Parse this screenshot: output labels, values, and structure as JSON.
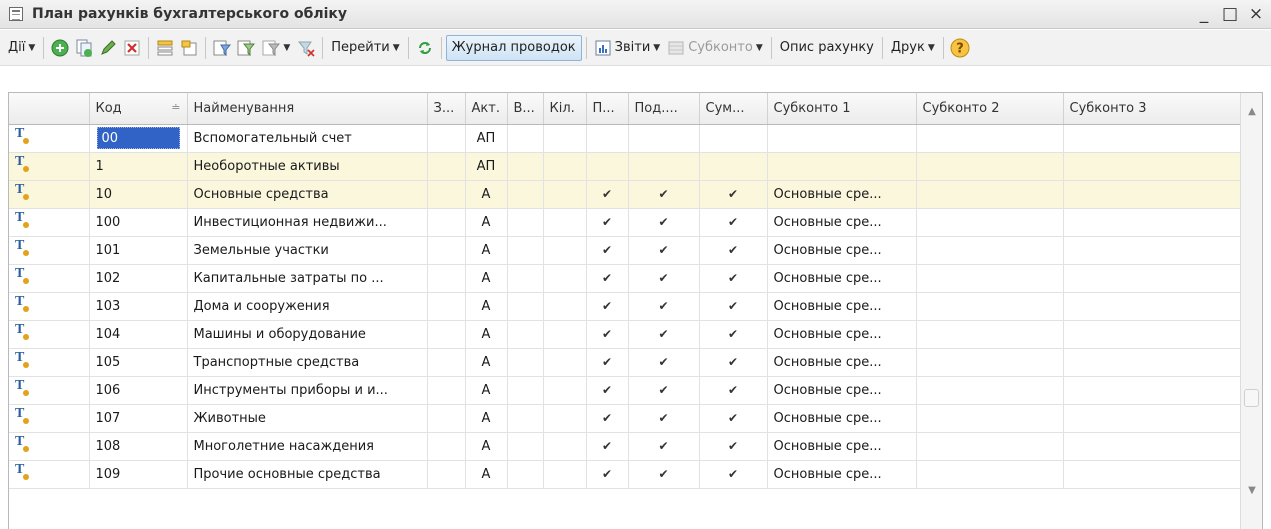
{
  "window": {
    "title": "План рахунків бухгалтерського обліку",
    "minimize": "_",
    "maximize": "□",
    "close": "×"
  },
  "toolbar": {
    "actions_label": "Дії",
    "goto_label": "Перейти",
    "journal_label": "Журнал проводок",
    "reports_label": "Звіти",
    "subconto_label": "Субконто",
    "account_desc_label": "Опис рахунку",
    "print_label": "Друк",
    "help_label": "?",
    "icons": [
      "add-icon",
      "copy-icon",
      "edit-icon",
      "delete-icon",
      "hierarchy-icon",
      "level-up-icon",
      "filter-icon",
      "filter-by-value-icon",
      "filter-history-icon",
      "clear-filter-icon",
      "refresh-icon"
    ]
  },
  "table": {
    "columns": [
      "",
      "Код",
      "Найменування",
      "З...",
      "Акт.",
      "В...",
      "Кіл.",
      "П...",
      "Под....",
      "Сум...",
      "Субконто 1",
      "Субконто 2",
      "Субконто 3"
    ],
    "rows": [
      {
        "code": "00",
        "name": "Вспомогательный счет",
        "z": "",
        "act": "АП",
        "v": "",
        "qty": "",
        "p": "",
        "pod": "",
        "sum": "",
        "sub1": "",
        "sub2": "",
        "sub3": "",
        "group": false,
        "selected": true
      },
      {
        "code": "1",
        "name": "Необоротные активы",
        "z": "",
        "act": "АП",
        "v": "",
        "qty": "",
        "p": "",
        "pod": "",
        "sum": "",
        "sub1": "",
        "sub2": "",
        "sub3": "",
        "group": true
      },
      {
        "code": "10",
        "name": "Основные средства",
        "z": "",
        "act": "А",
        "v": "",
        "qty": "",
        "p": "✔",
        "pod": "✔",
        "sum": "✔",
        "sub1": "Основные сре...",
        "sub2": "",
        "sub3": "",
        "group": true
      },
      {
        "code": "100",
        "name": "Инвестиционная недвижи...",
        "z": "",
        "act": "А",
        "v": "",
        "qty": "",
        "p": "✔",
        "pod": "✔",
        "sum": "✔",
        "sub1": "Основные сре...",
        "sub2": "",
        "sub3": "",
        "group": false
      },
      {
        "code": "101",
        "name": "Земельные участки",
        "z": "",
        "act": "А",
        "v": "",
        "qty": "",
        "p": "✔",
        "pod": "✔",
        "sum": "✔",
        "sub1": "Основные сре...",
        "sub2": "",
        "sub3": "",
        "group": false
      },
      {
        "code": "102",
        "name": "Капитальные затраты по ...",
        "z": "",
        "act": "А",
        "v": "",
        "qty": "",
        "p": "✔",
        "pod": "✔",
        "sum": "✔",
        "sub1": "Основные сре...",
        "sub2": "",
        "sub3": "",
        "group": false
      },
      {
        "code": "103",
        "name": "Дома и сооружения",
        "z": "",
        "act": "А",
        "v": "",
        "qty": "",
        "p": "✔",
        "pod": "✔",
        "sum": "✔",
        "sub1": "Основные сре...",
        "sub2": "",
        "sub3": "",
        "group": false
      },
      {
        "code": "104",
        "name": "Машины и оборудование",
        "z": "",
        "act": "А",
        "v": "",
        "qty": "",
        "p": "✔",
        "pod": "✔",
        "sum": "✔",
        "sub1": "Основные сре...",
        "sub2": "",
        "sub3": "",
        "group": false
      },
      {
        "code": "105",
        "name": "Транспортные средства",
        "z": "",
        "act": "А",
        "v": "",
        "qty": "",
        "p": "✔",
        "pod": "✔",
        "sum": "✔",
        "sub1": "Основные сре...",
        "sub2": "",
        "sub3": "",
        "group": false
      },
      {
        "code": "106",
        "name": "Инструменты приборы и и...",
        "z": "",
        "act": "А",
        "v": "",
        "qty": "",
        "p": "✔",
        "pod": "✔",
        "sum": "✔",
        "sub1": "Основные сре...",
        "sub2": "",
        "sub3": "",
        "group": false
      },
      {
        "code": "107",
        "name": "Животные",
        "z": "",
        "act": "А",
        "v": "",
        "qty": "",
        "p": "✔",
        "pod": "✔",
        "sum": "✔",
        "sub1": "Основные сре...",
        "sub2": "",
        "sub3": "",
        "group": false
      },
      {
        "code": "108",
        "name": "Многолетние насаждения",
        "z": "",
        "act": "А",
        "v": "",
        "qty": "",
        "p": "✔",
        "pod": "✔",
        "sum": "✔",
        "sub1": "Основные сре...",
        "sub2": "",
        "sub3": "",
        "group": false
      },
      {
        "code": "109",
        "name": "Прочие основные средства",
        "z": "",
        "act": "А",
        "v": "",
        "qty": "",
        "p": "✔",
        "pod": "✔",
        "sum": "✔",
        "sub1": "Основные сре...",
        "sub2": "",
        "sub3": "",
        "group": false
      }
    ]
  },
  "colors": {
    "selection": "#3163c6",
    "group_row": "#fbf7dd",
    "icon_blue": "#2a5fa0",
    "icon_orange": "#e4a21b"
  }
}
